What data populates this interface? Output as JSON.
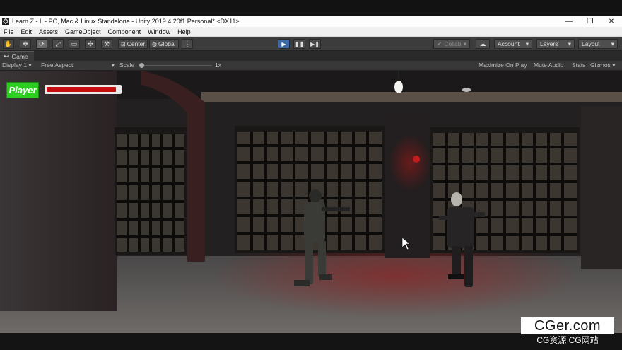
{
  "window": {
    "title": "Learn Z - L - PC, Mac & Linux Standalone - Unity 2019.4.20f1 Personal* <DX11>",
    "minimize": "—",
    "restore": "❐",
    "close": "✕"
  },
  "menu": [
    "File",
    "Edit",
    "Assets",
    "GameObject",
    "Component",
    "Window",
    "Help"
  ],
  "toolbar": {
    "pivot_label": "Center",
    "space_label": "Global",
    "collab_label": "Collab",
    "account_label": "Account",
    "layers_label": "Layers",
    "layout_label": "Layout",
    "play_active": true,
    "accent": "#3e6aa8"
  },
  "tab": {
    "label": "Game"
  },
  "gamebar": {
    "display": "Display 1",
    "aspect": "Free Aspect",
    "scale_label": "Scale",
    "scale_value": "1x",
    "maximize": "Maximize On Play",
    "mute": "Mute Audio",
    "stats": "Stats",
    "gizmos": "Gizmos"
  },
  "hud": {
    "player_label": "Player",
    "health_fraction": 0.95,
    "player_color": "#2fcc23",
    "health_color": "#c80d0d"
  },
  "watermark": {
    "main": "CGer.com",
    "sub": "CG资源 CG网站"
  }
}
